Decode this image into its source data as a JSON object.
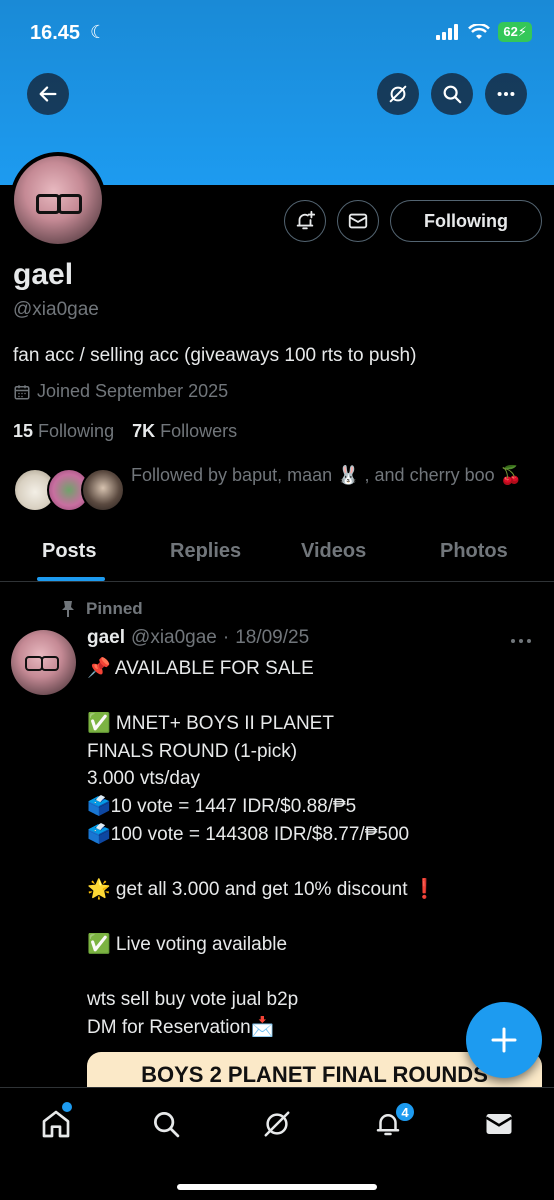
{
  "status_bar": {
    "time": "16.45",
    "battery": "62"
  },
  "header": {
    "back": "back-arrow-icon"
  },
  "profile": {
    "name": "gael",
    "handle": "@xia0gae",
    "bio": "fan acc / selling acc (giveaways 100 rts to push)",
    "joined": "Joined September 2025",
    "following_count": "15",
    "following_label": "Following",
    "followers_count": "7K",
    "followers_label": "Followers",
    "followed_by": "Followed by baput, maan 🐰 , and cherry boo 🍒",
    "follow_button": "Following"
  },
  "tabs": [
    "Posts",
    "Replies",
    "Videos",
    "Photos"
  ],
  "post": {
    "pinned_label": "Pinned",
    "author": "gael",
    "handle": "@xia0gae",
    "separator": "·",
    "date": "18/09/25",
    "lines": [
      "📌 AVAILABLE FOR SALE",
      "",
      "✅ MNET+ BOYS II PLANET",
      "FINALS ROUND (1-pick)",
      "3.000 vts/day",
      "🗳️10 vote =  1447 IDR/$0.88/₱5",
      "🗳️100 vote = 144308 IDR/$8.77/₱500",
      "",
      "🌟 get all 3.000 and get 10% discount ❗",
      "",
      "✅ Live voting available",
      "",
      "wts sell buy vote jual b2p",
      "DM for Reservation📩"
    ],
    "card_title": "BOYS 2 PLANET FINAL ROUNDS"
  },
  "bottom_nav": {
    "notifications_badge": "4"
  },
  "colors": {
    "accent": "#1d9bf0",
    "banner": "#1d9bf0",
    "background": "#000000",
    "muted": "#71767b"
  }
}
